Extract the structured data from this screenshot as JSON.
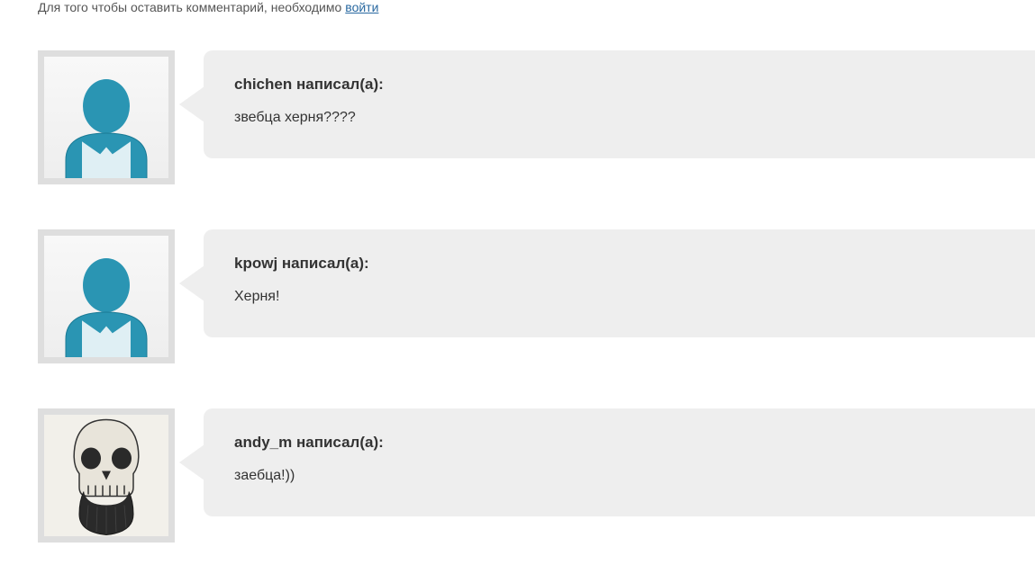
{
  "login_hint": {
    "prefix": "Для того чтобы оставить комментарий, необходимо",
    "link_label": "войти"
  },
  "wrote_suffix": "написал(а):",
  "comments": [
    {
      "author": "chichen",
      "text": "звебца херня????",
      "avatar": "default"
    },
    {
      "author": "kpowj",
      "text": "Херня!",
      "avatar": "default"
    },
    {
      "author": "andy_m",
      "text": "заебца!))",
      "avatar": "skull"
    }
  ]
}
